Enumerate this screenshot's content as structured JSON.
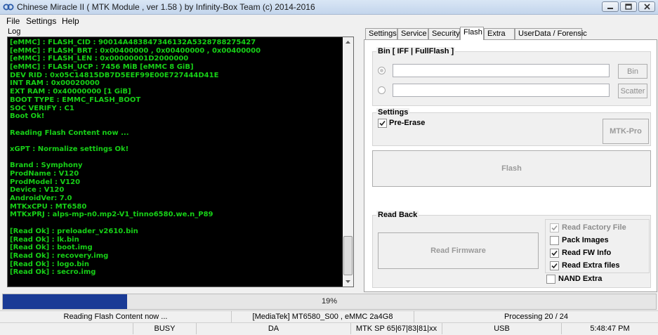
{
  "window": {
    "title": "Chinese Miracle II ( MTK Module , ver 1.58 ) by Infinity-Box Team (c) 2014-2016"
  },
  "menu": [
    "File",
    "Settings",
    "Help"
  ],
  "log": {
    "label": "Log",
    "lines": [
      "[eMMC] : FLASH_CID : 90014A483847346132A5328788275427",
      "[eMMC] : FLASH_BRT : 0x00400000 , 0x00400000 , 0x00400000",
      "[eMMC] : FLASH_LEN : 0x00000001D2000000",
      "[eMMC] : FLASH_UCP : 7456 MiB [eMMC 8 GiB]",
      "DEV RID    : 0x05C14815DB7D5EEF99E00E727444D41E",
      "INT RAM    : 0x00020000",
      "EXT RAM    : 0x40000000 [1 GiB]",
      "BOOT TYPE : EMMC_FLASH_BOOT",
      "SOC VERIFY : C1",
      "Boot Ok!",
      "",
      "Reading Flash Content now ...",
      "",
      "xGPT : Normalize settings Ok!",
      "",
      "Brand    : Symphony",
      "ProdName : V120",
      "ProdModel : V120",
      "Device    : V120",
      "AndroidVer: 7.0",
      "MTKxCPU   : MT6580",
      "MTKxPRJ   : alps-mp-n0.mp2-V1_tinno6580.we.n_P89",
      "",
      "[Read Ok] : preloader_v2610.bin",
      "[Read Ok] : lk.bin",
      "[Read Ok] : boot.img",
      "[Read Ok] : recovery.img",
      "[Read Ok] : logo.bin",
      "[Read Ok] : secro.img"
    ]
  },
  "tabs": [
    "Settings",
    "Service",
    "Security",
    "Flash",
    "Extra",
    "UserData / Forensic"
  ],
  "active_tab": "Flash",
  "flash": {
    "bin_group": "Bin  [ IFF | FullFlash ]",
    "bin_button": "Bin",
    "scatter_button": "Scatter",
    "settings_group": "Settings",
    "pre_erase": "Pre-Erase",
    "mtk_pro_button": "MTK-Pro",
    "flash_button": "Flash",
    "readback_group": "Read Back",
    "read_firmware_button": "Read Firmware",
    "read_factory_file": "Read Factory File",
    "pack_images": "Pack Images",
    "read_fw_info": "Read FW Info",
    "read_extra_files": "Read Extra files",
    "nand_extra": "NAND Extra"
  },
  "progress": {
    "percent": 19,
    "label": "19%",
    "fill_color": "#1a3b96"
  },
  "status_bar": {
    "message": "Reading Flash Content now ...",
    "device": "[MediaTek] MT6580_S00 , eMMC 2a4G8",
    "processing": "Processing 20 / 24",
    "state": "BUSY",
    "mode": "DA",
    "sp": "MTK SP 65|67|83|81|xx",
    "port": "USB",
    "time": "5:48:47 PM"
  }
}
